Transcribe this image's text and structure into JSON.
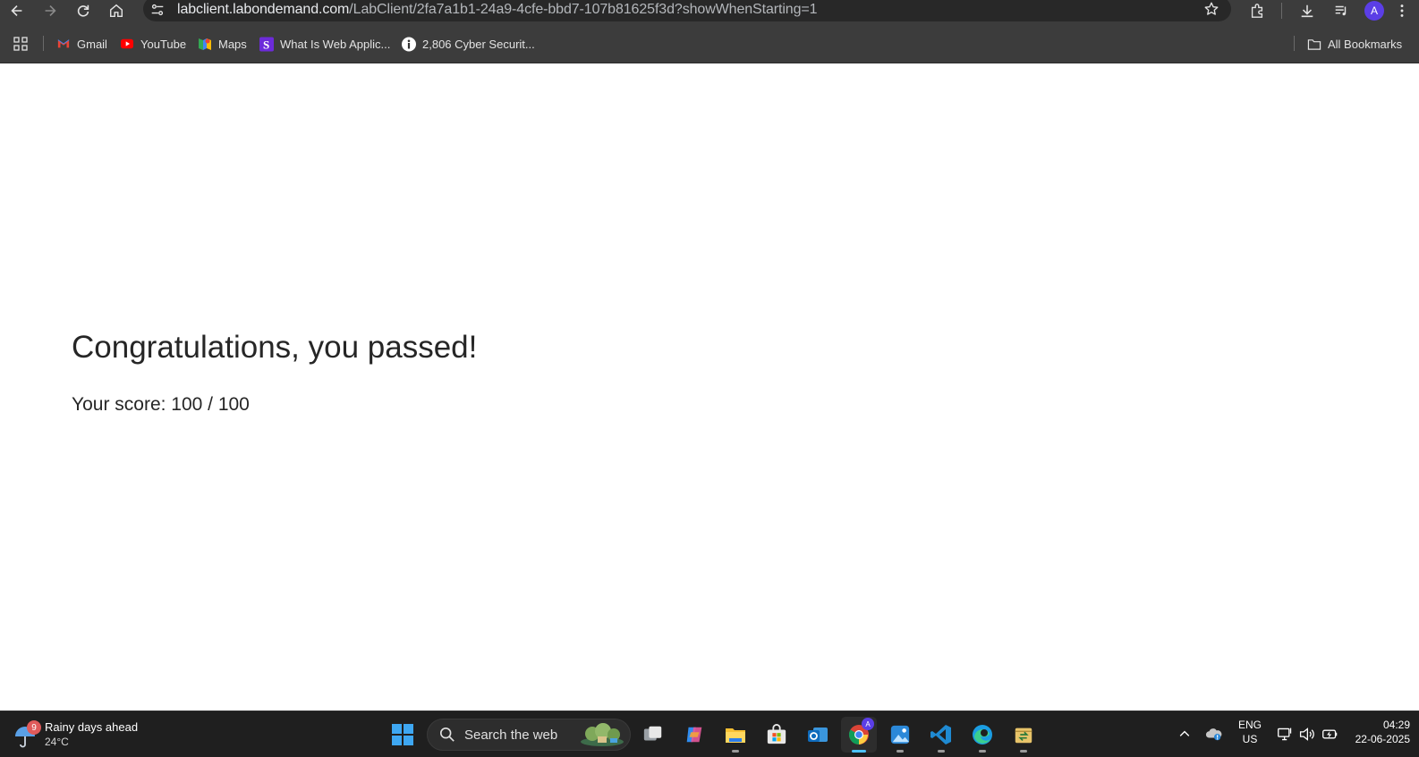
{
  "browser": {
    "url_host": "labclient.labondemand.com",
    "url_path": "/LabClient/2fa7a1b1-24a9-4cfe-bbd7-107b81625f3d?showWhenStarting=1",
    "profile_initial": "A",
    "profile_color": "#5b3ee6"
  },
  "bookmarks": {
    "items": [
      {
        "label": "Gmail",
        "icon": "gmail-icon"
      },
      {
        "label": "YouTube",
        "icon": "youtube-icon"
      },
      {
        "label": "Maps",
        "icon": "maps-icon"
      },
      {
        "label": "What Is Web Applic...",
        "icon": "s-site-icon"
      },
      {
        "label": "2,806 Cyber Securit...",
        "icon": "info-site-icon"
      }
    ],
    "all_bookmarks": "All Bookmarks"
  },
  "page": {
    "headline": "Congratulations, you passed!",
    "score_text": "Your score: 100 / 100"
  },
  "taskbar": {
    "weather_title": "Rainy days ahead",
    "weather_temp": "24°C",
    "weather_badge": "9",
    "search_placeholder": "Search the web",
    "apps": [
      "start",
      "search",
      "task-view",
      "copilot",
      "file-explorer",
      "microsoft-store",
      "outlook",
      "chrome",
      "photos",
      "vscode",
      "edge",
      "app"
    ],
    "chrome_badge": "A",
    "lang_top": "ENG",
    "lang_bottom": "US",
    "time": "04:29",
    "date": "22-06-2025",
    "accent_color": "#4cc2ff"
  }
}
